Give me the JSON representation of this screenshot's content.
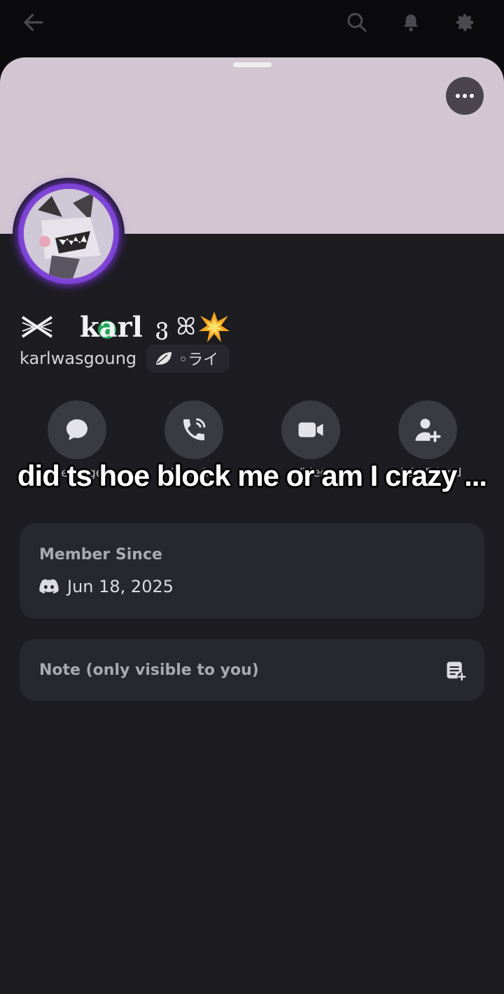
{
  "icons": {
    "back": "arrow-left",
    "search": "search",
    "bell": "bell",
    "settings": "gear",
    "more": "more-horizontal",
    "message": "chat-bubble",
    "call": "phone",
    "video": "video-camera",
    "add_friend": "user-plus",
    "discord": "discord-logo",
    "note": "note-edit"
  },
  "colors": {
    "banner": "#d3c5d2",
    "status_online": "#23a55a",
    "avatar_ring": "#a64df0",
    "background": "#1c1c21"
  },
  "profile": {
    "display_name": "karl",
    "name_suffix": "ვ ꕤ",
    "username": "karlwasgoung",
    "tag": "◦ライ"
  },
  "actions": [
    {
      "label": "Message"
    },
    {
      "label": "Voice Call"
    },
    {
      "label": "Video"
    },
    {
      "label": "Add Friend"
    }
  ],
  "caption": "did ts hoe block me or am I crazy ...",
  "member_since": {
    "title": "Member Since",
    "date": "Jun 18, 2025"
  },
  "note": {
    "placeholder": "Note (only visible to you)"
  }
}
